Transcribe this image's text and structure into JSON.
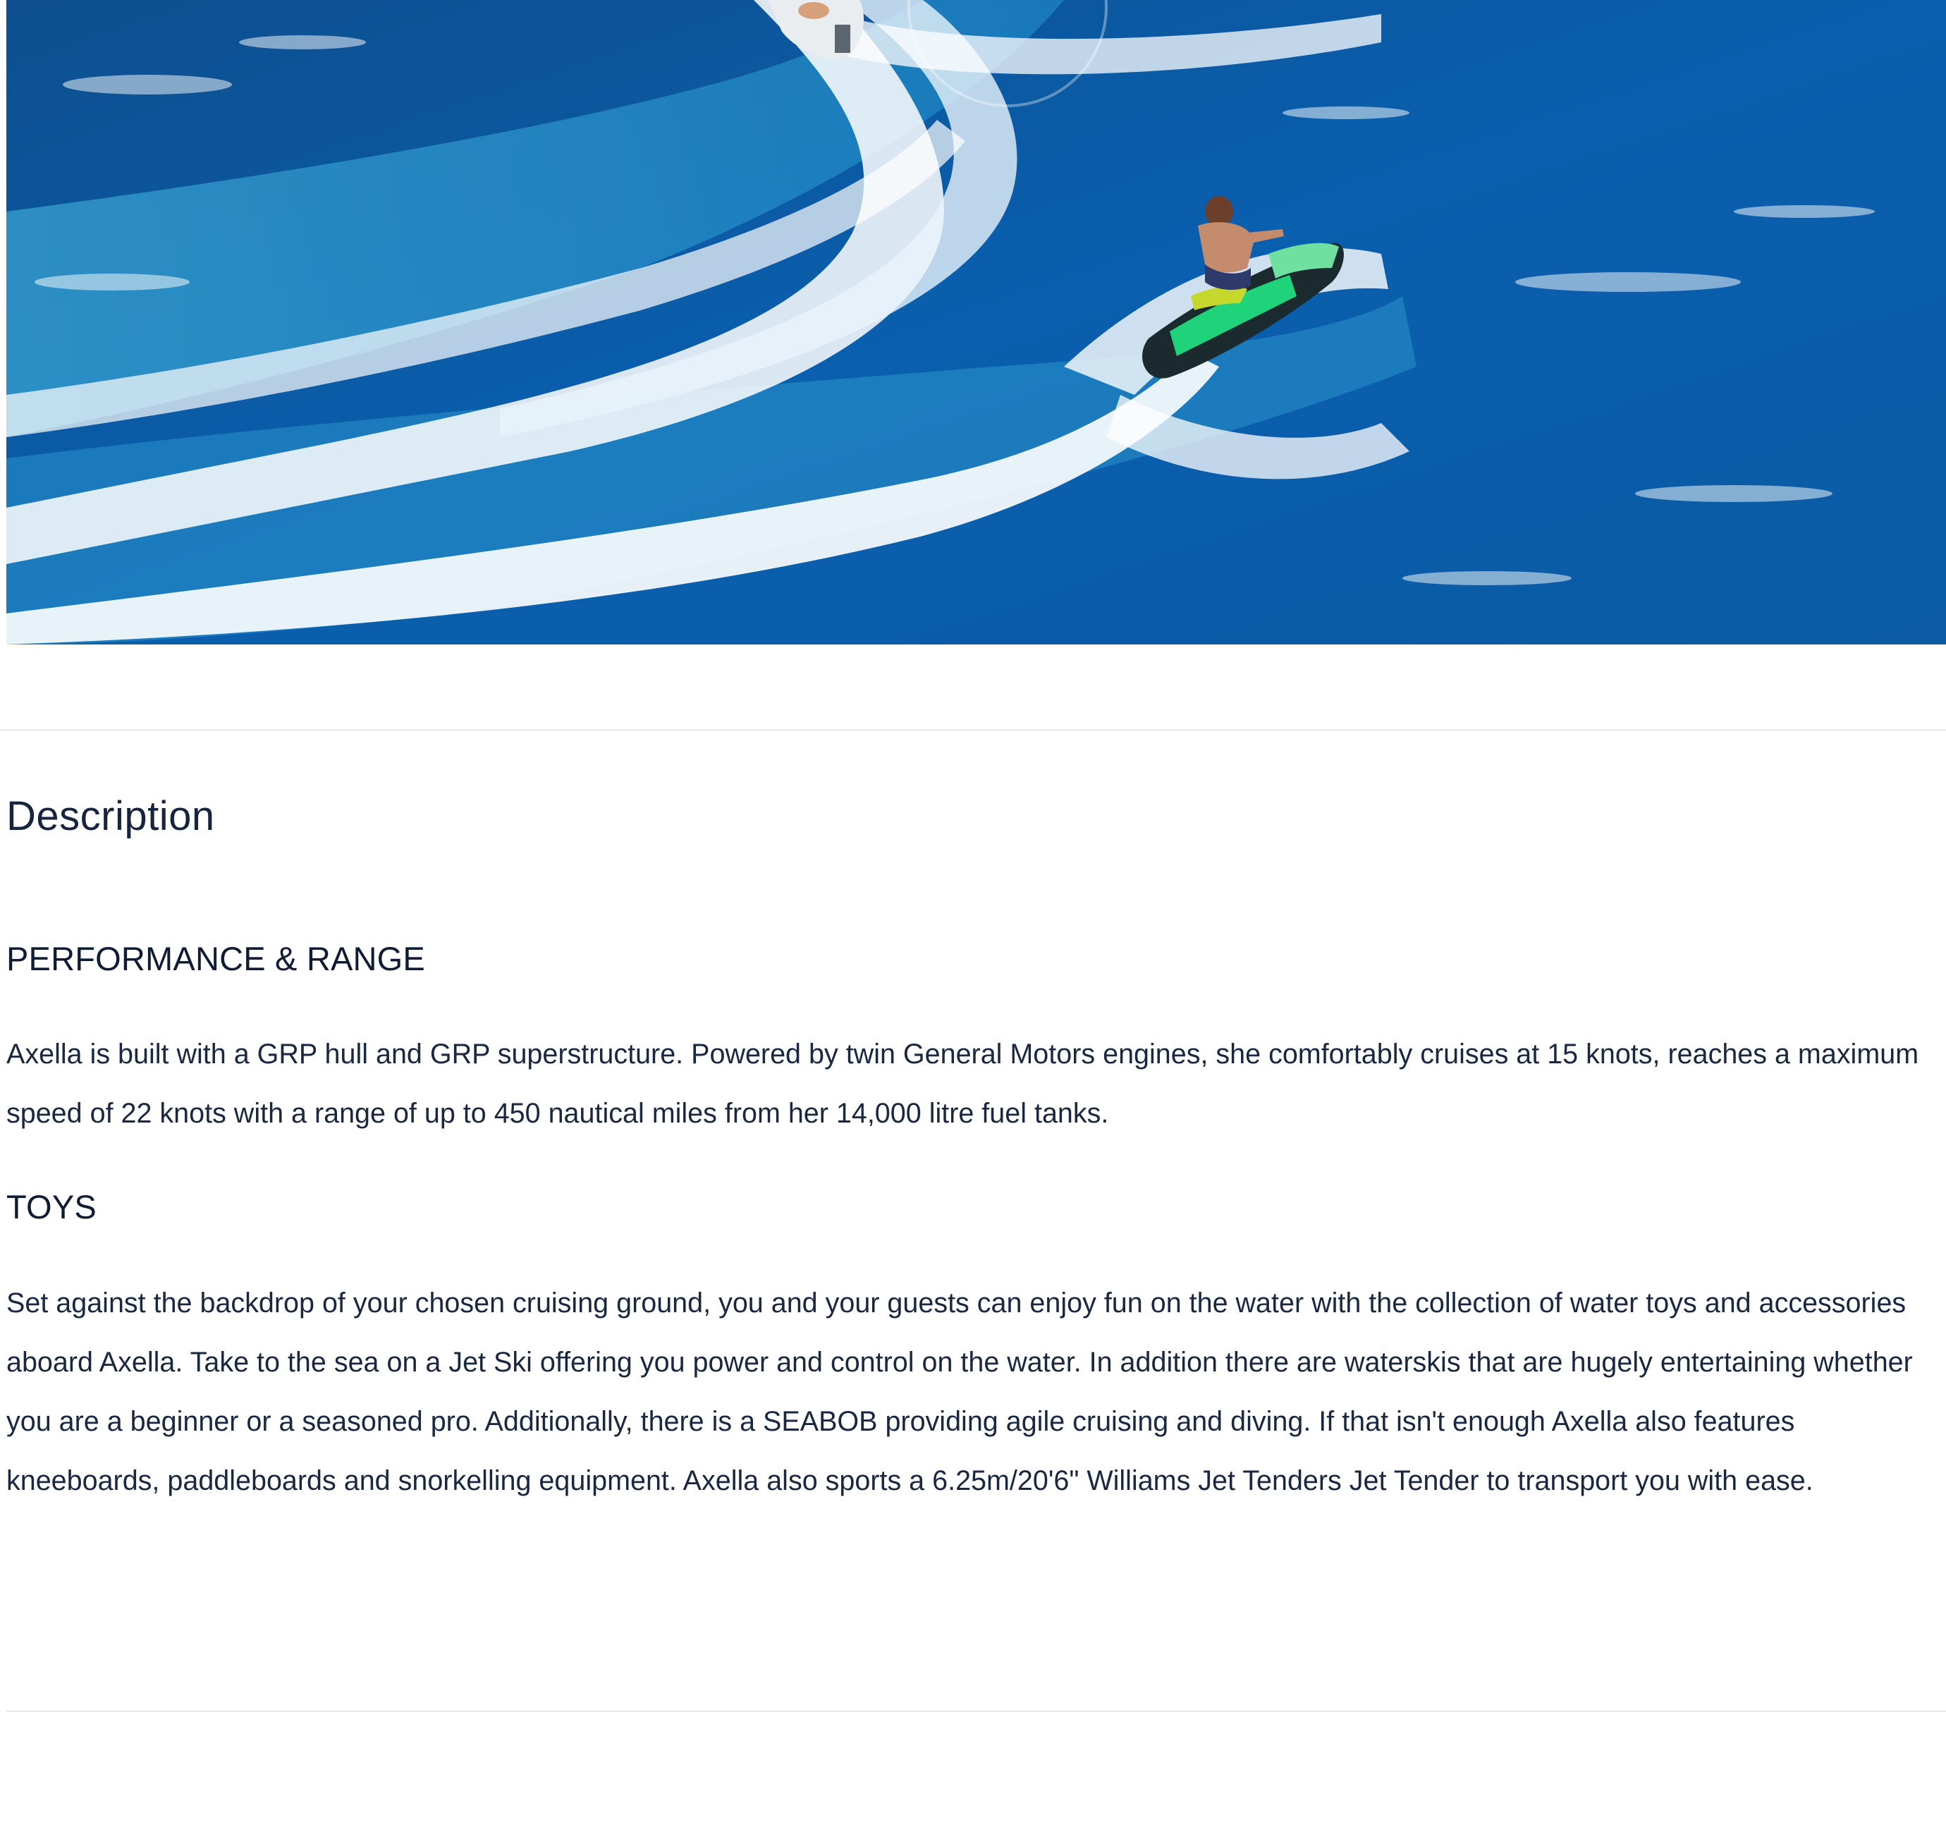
{
  "description_section": {
    "title": "Description",
    "performance": {
      "heading": "PERFORMANCE & RANGE",
      "text": "Axella is built with a GRP hull and GRP superstructure. Powered by twin General Motors engines, she comfortably cruises at 15 knots, reaches a maximum speed of 22 knots with a range of up to 450 nautical miles from her 14,000 litre fuel tanks."
    },
    "toys": {
      "heading": "TOYS",
      "text": "Set against the backdrop of your chosen cruising ground, you and your guests can enjoy fun on the water with the collection of water toys and accessories aboard Axella. Take to the sea on a Jet Ski offering you power and control on the water. In addition there are waterskis that are hugely entertaining whether you are a beginner or a seasoned pro. Additionally, there is a SEABOB providing agile cruising and diving. If that isn't enough Axella also features kneeboards, paddleboards and snorkelling equipment. Axella also sports a 6.25m/20'6\" Williams Jet Tenders Jet Tender to transport you with ease."
    }
  },
  "colors": {
    "sea": "#0a5aa6",
    "foam": "#ffffff",
    "jetski_accent": "#1fd37a",
    "text": "#0f1c33",
    "divider": "#e6e9ee"
  }
}
